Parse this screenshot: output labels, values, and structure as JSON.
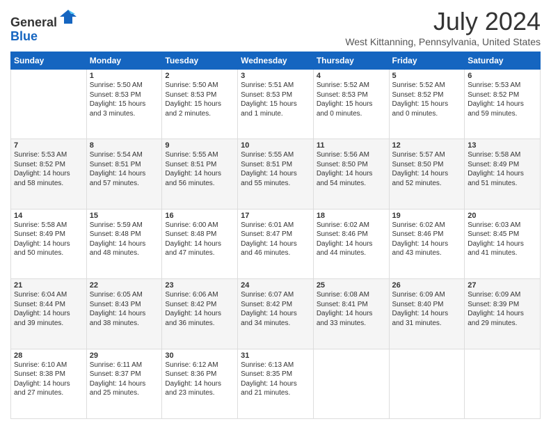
{
  "logo": {
    "general": "General",
    "blue": "Blue"
  },
  "title": "July 2024",
  "subtitle": "West Kittanning, Pennsylvania, United States",
  "weekdays": [
    "Sunday",
    "Monday",
    "Tuesday",
    "Wednesday",
    "Thursday",
    "Friday",
    "Saturday"
  ],
  "weeks": [
    [
      {
        "day": "",
        "sunrise": "",
        "sunset": "",
        "daylight": ""
      },
      {
        "day": "1",
        "sunrise": "Sunrise: 5:50 AM",
        "sunset": "Sunset: 8:53 PM",
        "daylight": "Daylight: 15 hours and 3 minutes."
      },
      {
        "day": "2",
        "sunrise": "Sunrise: 5:50 AM",
        "sunset": "Sunset: 8:53 PM",
        "daylight": "Daylight: 15 hours and 2 minutes."
      },
      {
        "day": "3",
        "sunrise": "Sunrise: 5:51 AM",
        "sunset": "Sunset: 8:53 PM",
        "daylight": "Daylight: 15 hours and 1 minute."
      },
      {
        "day": "4",
        "sunrise": "Sunrise: 5:52 AM",
        "sunset": "Sunset: 8:53 PM",
        "daylight": "Daylight: 15 hours and 0 minutes."
      },
      {
        "day": "5",
        "sunrise": "Sunrise: 5:52 AM",
        "sunset": "Sunset: 8:52 PM",
        "daylight": "Daylight: 15 hours and 0 minutes."
      },
      {
        "day": "6",
        "sunrise": "Sunrise: 5:53 AM",
        "sunset": "Sunset: 8:52 PM",
        "daylight": "Daylight: 14 hours and 59 minutes."
      }
    ],
    [
      {
        "day": "7",
        "sunrise": "Sunrise: 5:53 AM",
        "sunset": "Sunset: 8:52 PM",
        "daylight": "Daylight: 14 hours and 58 minutes."
      },
      {
        "day": "8",
        "sunrise": "Sunrise: 5:54 AM",
        "sunset": "Sunset: 8:51 PM",
        "daylight": "Daylight: 14 hours and 57 minutes."
      },
      {
        "day": "9",
        "sunrise": "Sunrise: 5:55 AM",
        "sunset": "Sunset: 8:51 PM",
        "daylight": "Daylight: 14 hours and 56 minutes."
      },
      {
        "day": "10",
        "sunrise": "Sunrise: 5:55 AM",
        "sunset": "Sunset: 8:51 PM",
        "daylight": "Daylight: 14 hours and 55 minutes."
      },
      {
        "day": "11",
        "sunrise": "Sunrise: 5:56 AM",
        "sunset": "Sunset: 8:50 PM",
        "daylight": "Daylight: 14 hours and 54 minutes."
      },
      {
        "day": "12",
        "sunrise": "Sunrise: 5:57 AM",
        "sunset": "Sunset: 8:50 PM",
        "daylight": "Daylight: 14 hours and 52 minutes."
      },
      {
        "day": "13",
        "sunrise": "Sunrise: 5:58 AM",
        "sunset": "Sunset: 8:49 PM",
        "daylight": "Daylight: 14 hours and 51 minutes."
      }
    ],
    [
      {
        "day": "14",
        "sunrise": "Sunrise: 5:58 AM",
        "sunset": "Sunset: 8:49 PM",
        "daylight": "Daylight: 14 hours and 50 minutes."
      },
      {
        "day": "15",
        "sunrise": "Sunrise: 5:59 AM",
        "sunset": "Sunset: 8:48 PM",
        "daylight": "Daylight: 14 hours and 48 minutes."
      },
      {
        "day": "16",
        "sunrise": "Sunrise: 6:00 AM",
        "sunset": "Sunset: 8:48 PM",
        "daylight": "Daylight: 14 hours and 47 minutes."
      },
      {
        "day": "17",
        "sunrise": "Sunrise: 6:01 AM",
        "sunset": "Sunset: 8:47 PM",
        "daylight": "Daylight: 14 hours and 46 minutes."
      },
      {
        "day": "18",
        "sunrise": "Sunrise: 6:02 AM",
        "sunset": "Sunset: 8:46 PM",
        "daylight": "Daylight: 14 hours and 44 minutes."
      },
      {
        "day": "19",
        "sunrise": "Sunrise: 6:02 AM",
        "sunset": "Sunset: 8:46 PM",
        "daylight": "Daylight: 14 hours and 43 minutes."
      },
      {
        "day": "20",
        "sunrise": "Sunrise: 6:03 AM",
        "sunset": "Sunset: 8:45 PM",
        "daylight": "Daylight: 14 hours and 41 minutes."
      }
    ],
    [
      {
        "day": "21",
        "sunrise": "Sunrise: 6:04 AM",
        "sunset": "Sunset: 8:44 PM",
        "daylight": "Daylight: 14 hours and 39 minutes."
      },
      {
        "day": "22",
        "sunrise": "Sunrise: 6:05 AM",
        "sunset": "Sunset: 8:43 PM",
        "daylight": "Daylight: 14 hours and 38 minutes."
      },
      {
        "day": "23",
        "sunrise": "Sunrise: 6:06 AM",
        "sunset": "Sunset: 8:42 PM",
        "daylight": "Daylight: 14 hours and 36 minutes."
      },
      {
        "day": "24",
        "sunrise": "Sunrise: 6:07 AM",
        "sunset": "Sunset: 8:42 PM",
        "daylight": "Daylight: 14 hours and 34 minutes."
      },
      {
        "day": "25",
        "sunrise": "Sunrise: 6:08 AM",
        "sunset": "Sunset: 8:41 PM",
        "daylight": "Daylight: 14 hours and 33 minutes."
      },
      {
        "day": "26",
        "sunrise": "Sunrise: 6:09 AM",
        "sunset": "Sunset: 8:40 PM",
        "daylight": "Daylight: 14 hours and 31 minutes."
      },
      {
        "day": "27",
        "sunrise": "Sunrise: 6:09 AM",
        "sunset": "Sunset: 8:39 PM",
        "daylight": "Daylight: 14 hours and 29 minutes."
      }
    ],
    [
      {
        "day": "28",
        "sunrise": "Sunrise: 6:10 AM",
        "sunset": "Sunset: 8:38 PM",
        "daylight": "Daylight: 14 hours and 27 minutes."
      },
      {
        "day": "29",
        "sunrise": "Sunrise: 6:11 AM",
        "sunset": "Sunset: 8:37 PM",
        "daylight": "Daylight: 14 hours and 25 minutes."
      },
      {
        "day": "30",
        "sunrise": "Sunrise: 6:12 AM",
        "sunset": "Sunset: 8:36 PM",
        "daylight": "Daylight: 14 hours and 23 minutes."
      },
      {
        "day": "31",
        "sunrise": "Sunrise: 6:13 AM",
        "sunset": "Sunset: 8:35 PM",
        "daylight": "Daylight: 14 hours and 21 minutes."
      },
      {
        "day": "",
        "sunrise": "",
        "sunset": "",
        "daylight": ""
      },
      {
        "day": "",
        "sunrise": "",
        "sunset": "",
        "daylight": ""
      },
      {
        "day": "",
        "sunrise": "",
        "sunset": "",
        "daylight": ""
      }
    ]
  ]
}
